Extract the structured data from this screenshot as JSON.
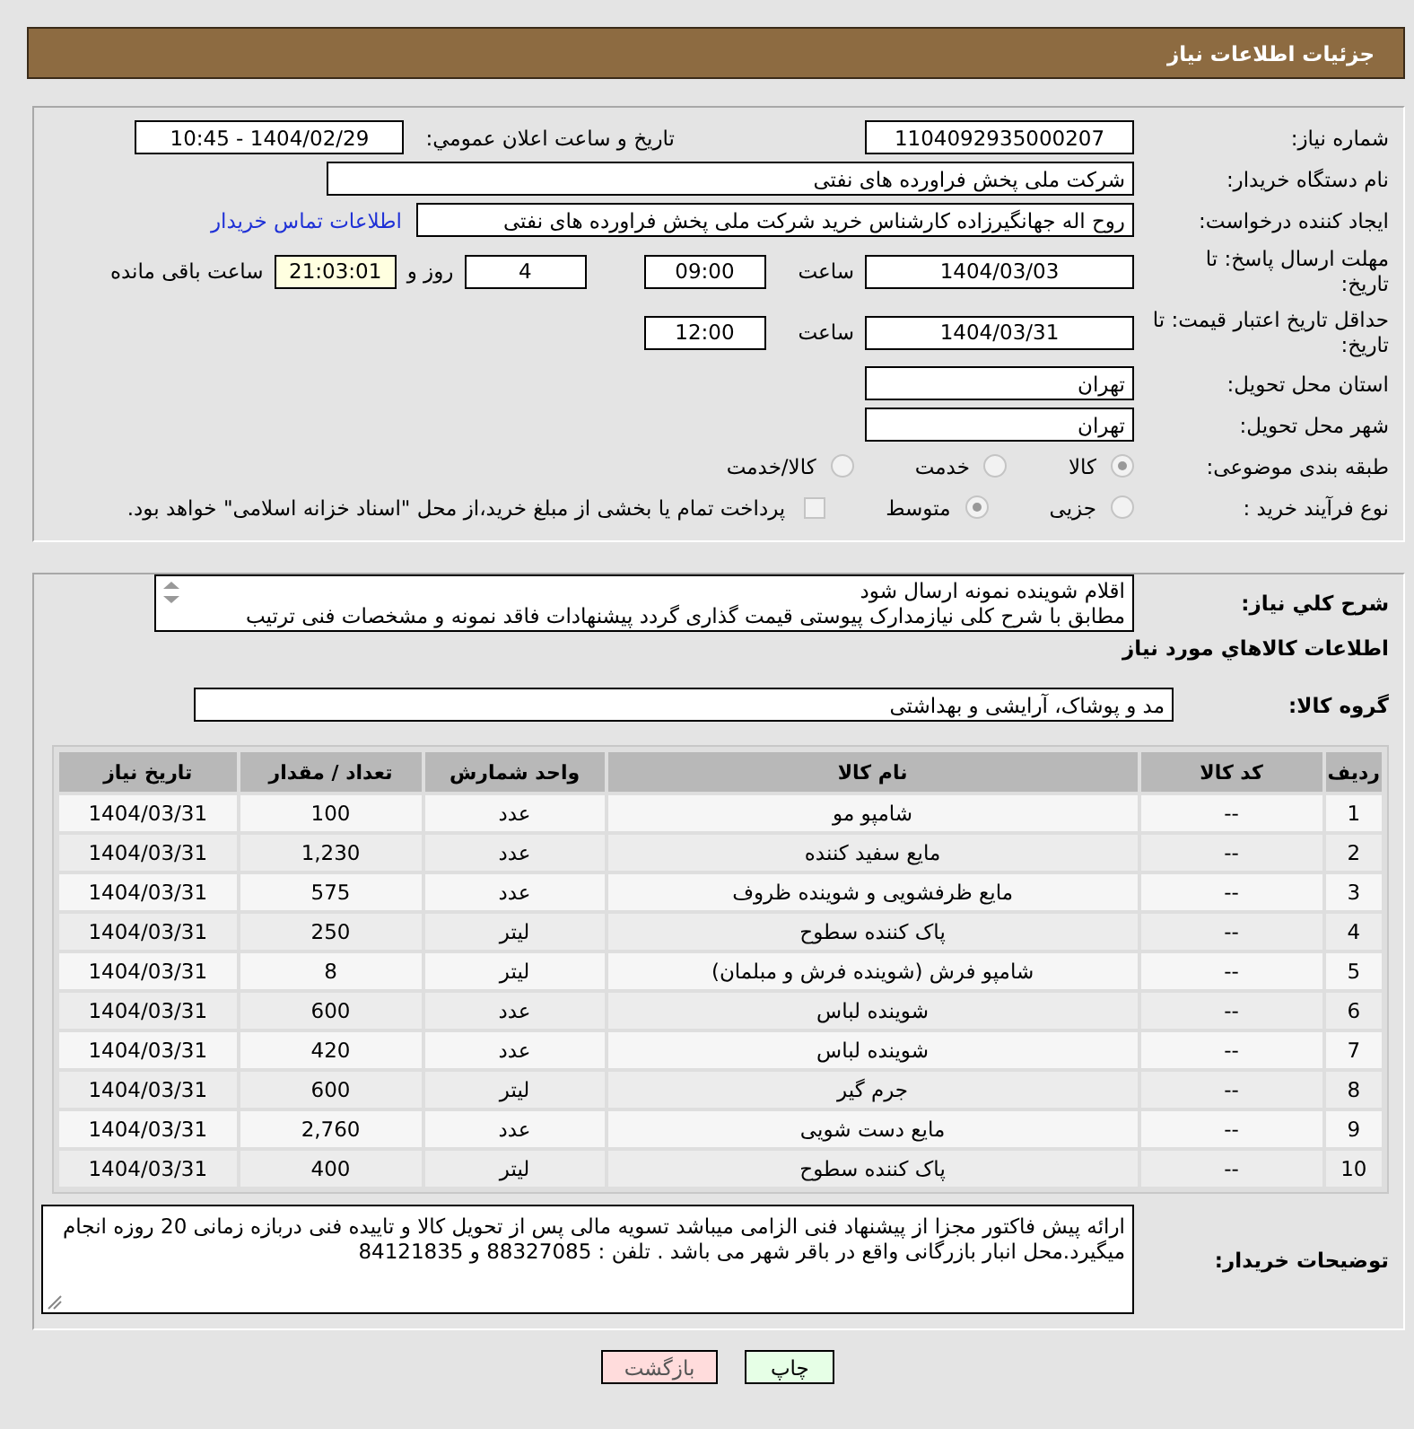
{
  "header": {
    "title": "جزئیات اطلاعات نیاز"
  },
  "need_number": {
    "label": "شماره نیاز:",
    "value": "1104092935000207"
  },
  "announce": {
    "label": "تاریخ و ساعت اعلان عمومي:",
    "value": "1404/02/29 - 10:45"
  },
  "buyer_org": {
    "label": "نام دستگاه خریدار:",
    "value": "شرکت ملی پخش فراورده های نفتی"
  },
  "creator": {
    "label": "ایجاد کننده درخواست:",
    "value": "روح اله جهانگیرزاده کارشناس خرید شرکت ملی پخش فراورده های نفتی",
    "link": "اطلاعات تماس خریدار"
  },
  "deadline": {
    "label": "مهلت ارسال پاسخ: تا تاریخ:",
    "date": "1404/03/03",
    "time_label": "ساعت",
    "time": "09:00",
    "days": "4",
    "days_label": "روز و",
    "remaining": "21:03:01",
    "remaining_label": "ساعت باقی مانده"
  },
  "validity": {
    "label": "حداقل تاریخ اعتبار قیمت: تا تاریخ:",
    "date": "1404/03/31",
    "time_label": "ساعت",
    "time": "12:00"
  },
  "province": {
    "label": "استان محل تحویل:",
    "value": "تهران"
  },
  "city": {
    "label": "شهر محل تحویل:",
    "value": "تهران"
  },
  "category": {
    "label": "طبقه بندی موضوعی:",
    "options": [
      {
        "label": "کالا",
        "selected": true,
        "disabled": true
      },
      {
        "label": "خدمت",
        "selected": false,
        "disabled": true
      },
      {
        "label": "کالا/خدمت",
        "selected": false,
        "disabled": true
      }
    ]
  },
  "process": {
    "label": "نوع فرآیند خرید :",
    "options": [
      {
        "label": "جزیی",
        "selected": false,
        "disabled": true
      },
      {
        "label": "متوسط",
        "selected": true,
        "disabled": true
      }
    ],
    "payment": {
      "label": "پرداخت تمام یا بخشی از مبلغ خرید،از محل \"اسناد خزانه اسلامی\" خواهد بود.",
      "checked": false,
      "disabled": true
    }
  },
  "description": {
    "label": "شرح کلي نیاز:",
    "value": "اقلام شوینده نمونه ارسال شود\nمطابق با شرح کلی نیازمدارک پیوستی قیمت گذاری گردد پیشنهادات فاقد نمونه و مشخصات فنی ترتیب"
  },
  "goods_section": {
    "title": "اطلاعات کالاهاي مورد نیاز"
  },
  "goods_group": {
    "label": "گروه کالا:",
    "value": "مد و پوشاک، آرایشی و بهداشتی"
  },
  "table": {
    "columns": [
      "ردیف",
      "کد کالا",
      "نام کالا",
      "واحد شمارش",
      "تعداد / مقدار",
      "تاریخ نیاز"
    ],
    "rows": [
      [
        "1",
        "--",
        "شامپو مو",
        "عدد",
        "100",
        "1404/03/31"
      ],
      [
        "2",
        "--",
        "مایع سفید کننده",
        "عدد",
        "1,230",
        "1404/03/31"
      ],
      [
        "3",
        "--",
        "مایع ظرفشویی و شوینده ظروف",
        "عدد",
        "575",
        "1404/03/31"
      ],
      [
        "4",
        "--",
        "پاک کننده سطوح",
        "لیتر",
        "250",
        "1404/03/31"
      ],
      [
        "5",
        "--",
        "شامپو فرش (شوینده فرش و مبلمان)",
        "لیتر",
        "8",
        "1404/03/31"
      ],
      [
        "6",
        "--",
        "شوینده لباس",
        "عدد",
        "600",
        "1404/03/31"
      ],
      [
        "7",
        "--",
        "شوینده لباس",
        "عدد",
        "420",
        "1404/03/31"
      ],
      [
        "8",
        "--",
        "جرم گیر",
        "لیتر",
        "600",
        "1404/03/31"
      ],
      [
        "9",
        "--",
        "مایع دست شویی",
        "عدد",
        "2,760",
        "1404/03/31"
      ],
      [
        "10",
        "--",
        "پاک کننده سطوح",
        "لیتر",
        "400",
        "1404/03/31"
      ]
    ]
  },
  "buyer_notes": {
    "label": "توضیحات خریدار:",
    "value": "ارائه پیش فاکتور مجزا از پیشنهاد فنی الزامی میباشد تسویه مالی پس از تحویل کالا و تاییده فنی دربازه زمانی 20 روزه انجام میگیرد.محل انبار بازرگانی واقع در باقر شهر می باشد . تلفن : 88327085 و 84121835"
  },
  "buttons": [
    {
      "label": "چاپ",
      "kind": "print"
    },
    {
      "label": "بازگشت",
      "kind": "back"
    }
  ]
}
